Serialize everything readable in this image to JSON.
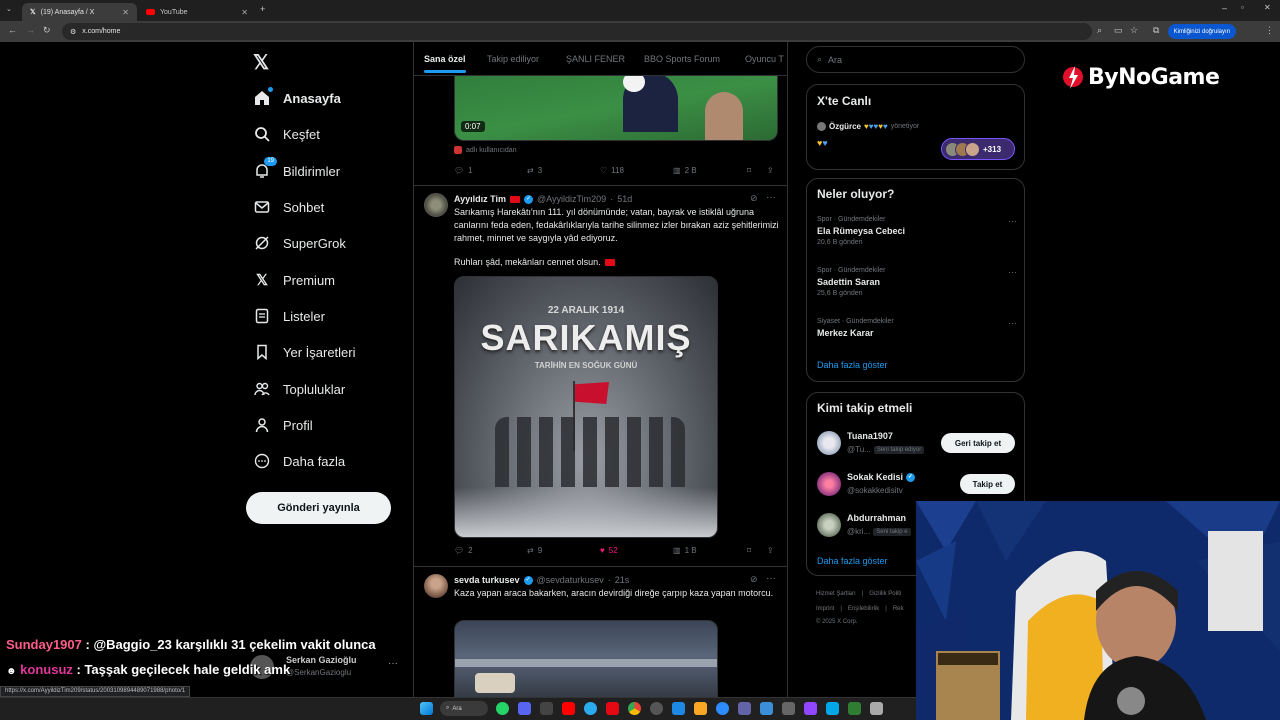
{
  "browser": {
    "tabs": [
      {
        "title": "(19) Anasayfa / X",
        "icon": "x-logo-icon"
      },
      {
        "title": "YouTube",
        "icon": "youtube-icon"
      }
    ],
    "url": "x.com/home",
    "verify_label": "Kimliğinizi doğrulayın"
  },
  "nav": {
    "items": [
      {
        "label": "Anasayfa",
        "icon": "home-icon"
      },
      {
        "label": "Keşfet",
        "icon": "search-icon"
      },
      {
        "label": "Bildirimler",
        "icon": "bell-icon",
        "badge": "19"
      },
      {
        "label": "Sohbet",
        "icon": "mail-icon"
      },
      {
        "label": "SuperGrok",
        "icon": "grok-icon"
      },
      {
        "label": "Premium",
        "icon": "x-icon"
      },
      {
        "label": "Listeler",
        "icon": "list-icon"
      },
      {
        "label": "Yer İşaretleri",
        "icon": "bookmark-icon"
      },
      {
        "label": "Topluluklar",
        "icon": "people-icon"
      },
      {
        "label": "Profil",
        "icon": "person-icon"
      },
      {
        "label": "Daha fazla",
        "icon": "more-circle-icon"
      }
    ],
    "post_button": "Gönderi yayınla"
  },
  "timeline": {
    "tabs": [
      "Sana özel",
      "Takip ediliyor",
      "ŞANLI FENER",
      "BBO Sports Forum",
      "Oyuncu T"
    ],
    "video_post": {
      "duration": "0:07",
      "source_note": "adlı kullanıcıdan",
      "replies": "1",
      "reposts": "3",
      "likes": "118",
      "views": "2 B"
    },
    "post1": {
      "name": "Ayyıldız Tim",
      "handle": "@AyyildizTim209",
      "time": "51d",
      "text": "Sarıkamış Harekâtı'nın 111. yıl dönümünde; vatan, bayrak ve istiklâl uğruna canlarını feda eden, fedakârlıklarıyla tarihe silinmez izler bırakan aziz şehitlerimizi rahmet, minnet ve saygıyla yâd ediyoruz.",
      "text2": "Ruhları şâd, mekânları cennet olsun.",
      "image": {
        "date": "22 ARALIK 1914",
        "title": "SARIKAMIŞ",
        "subtitle": "TARİHİN EN SOĞUK GÜNÜ"
      },
      "replies": "2",
      "reposts": "9",
      "likes": "52",
      "views": "1 B"
    },
    "post2": {
      "name": "sevda turkusev",
      "handle": "@sevdaturkusev",
      "time": "21s",
      "text": "Kaza yapan araca bakarken, aracın devirdiği direğe çarpıp kaza yapan motorcu."
    }
  },
  "right": {
    "search_placeholder": "Ara",
    "live": {
      "title": "X'te Canlı",
      "host": "Özgürce",
      "host_suffix": "yönetiyor",
      "listeners": "+313"
    },
    "trends": {
      "title": "Neler oluyor?",
      "items": [
        {
          "category": "Spor · Gündemdekiler",
          "name": "Ela Rümeysa Cebeci",
          "count": "20,6 B gönderi"
        },
        {
          "category": "Spor · Gündemdekiler",
          "name": "Sadettin Saran",
          "count": "25,6 B gönderi"
        },
        {
          "category": "Siyaset · Gündemdekiler",
          "name": "Merkez Karar",
          "count": ""
        }
      ],
      "show_more": "Daha fazla göster"
    },
    "follow": {
      "title": "Kimi takip etmeli",
      "items": [
        {
          "name": "Tuana1907",
          "handle": "@Tu...",
          "note": "Seni takip ediyor",
          "button": "Geri takip et"
        },
        {
          "name": "Sokak Kedisi",
          "handle": "@sokakkedisitv",
          "note": "",
          "button": "Takip et"
        },
        {
          "name": "Abdurrahman",
          "handle": "@kri...",
          "note": "Seni takip e",
          "button": ""
        }
      ],
      "show_more": "Daha fazla göster"
    },
    "footer": {
      "line1": [
        "Hizmet Şartları",
        "Gizlilik Politi"
      ],
      "line2": [
        "Imprint",
        "Erişilebilirlik",
        "Rek"
      ],
      "copyright": "© 2025 X Corp."
    }
  },
  "overlay": {
    "logo": "ByNoGame",
    "chat": [
      {
        "user": "Sunday1907",
        "user_color": "#ff5c8a",
        "message": "@Baggio_23 karşılıklı 31 çekelim vakit olunca"
      },
      {
        "user": "konusuz",
        "user_color": "#e0379a",
        "message": "Taşşak geçilecek hale geldik amk"
      }
    ],
    "account": {
      "name": "Serkan Gazioğlu",
      "handle": "@SerkanGazioglu"
    },
    "status_url": "https://x.com/AyyildizTim209/status/2003109894489071988/photo/1",
    "taskbar_search": "Ara"
  }
}
